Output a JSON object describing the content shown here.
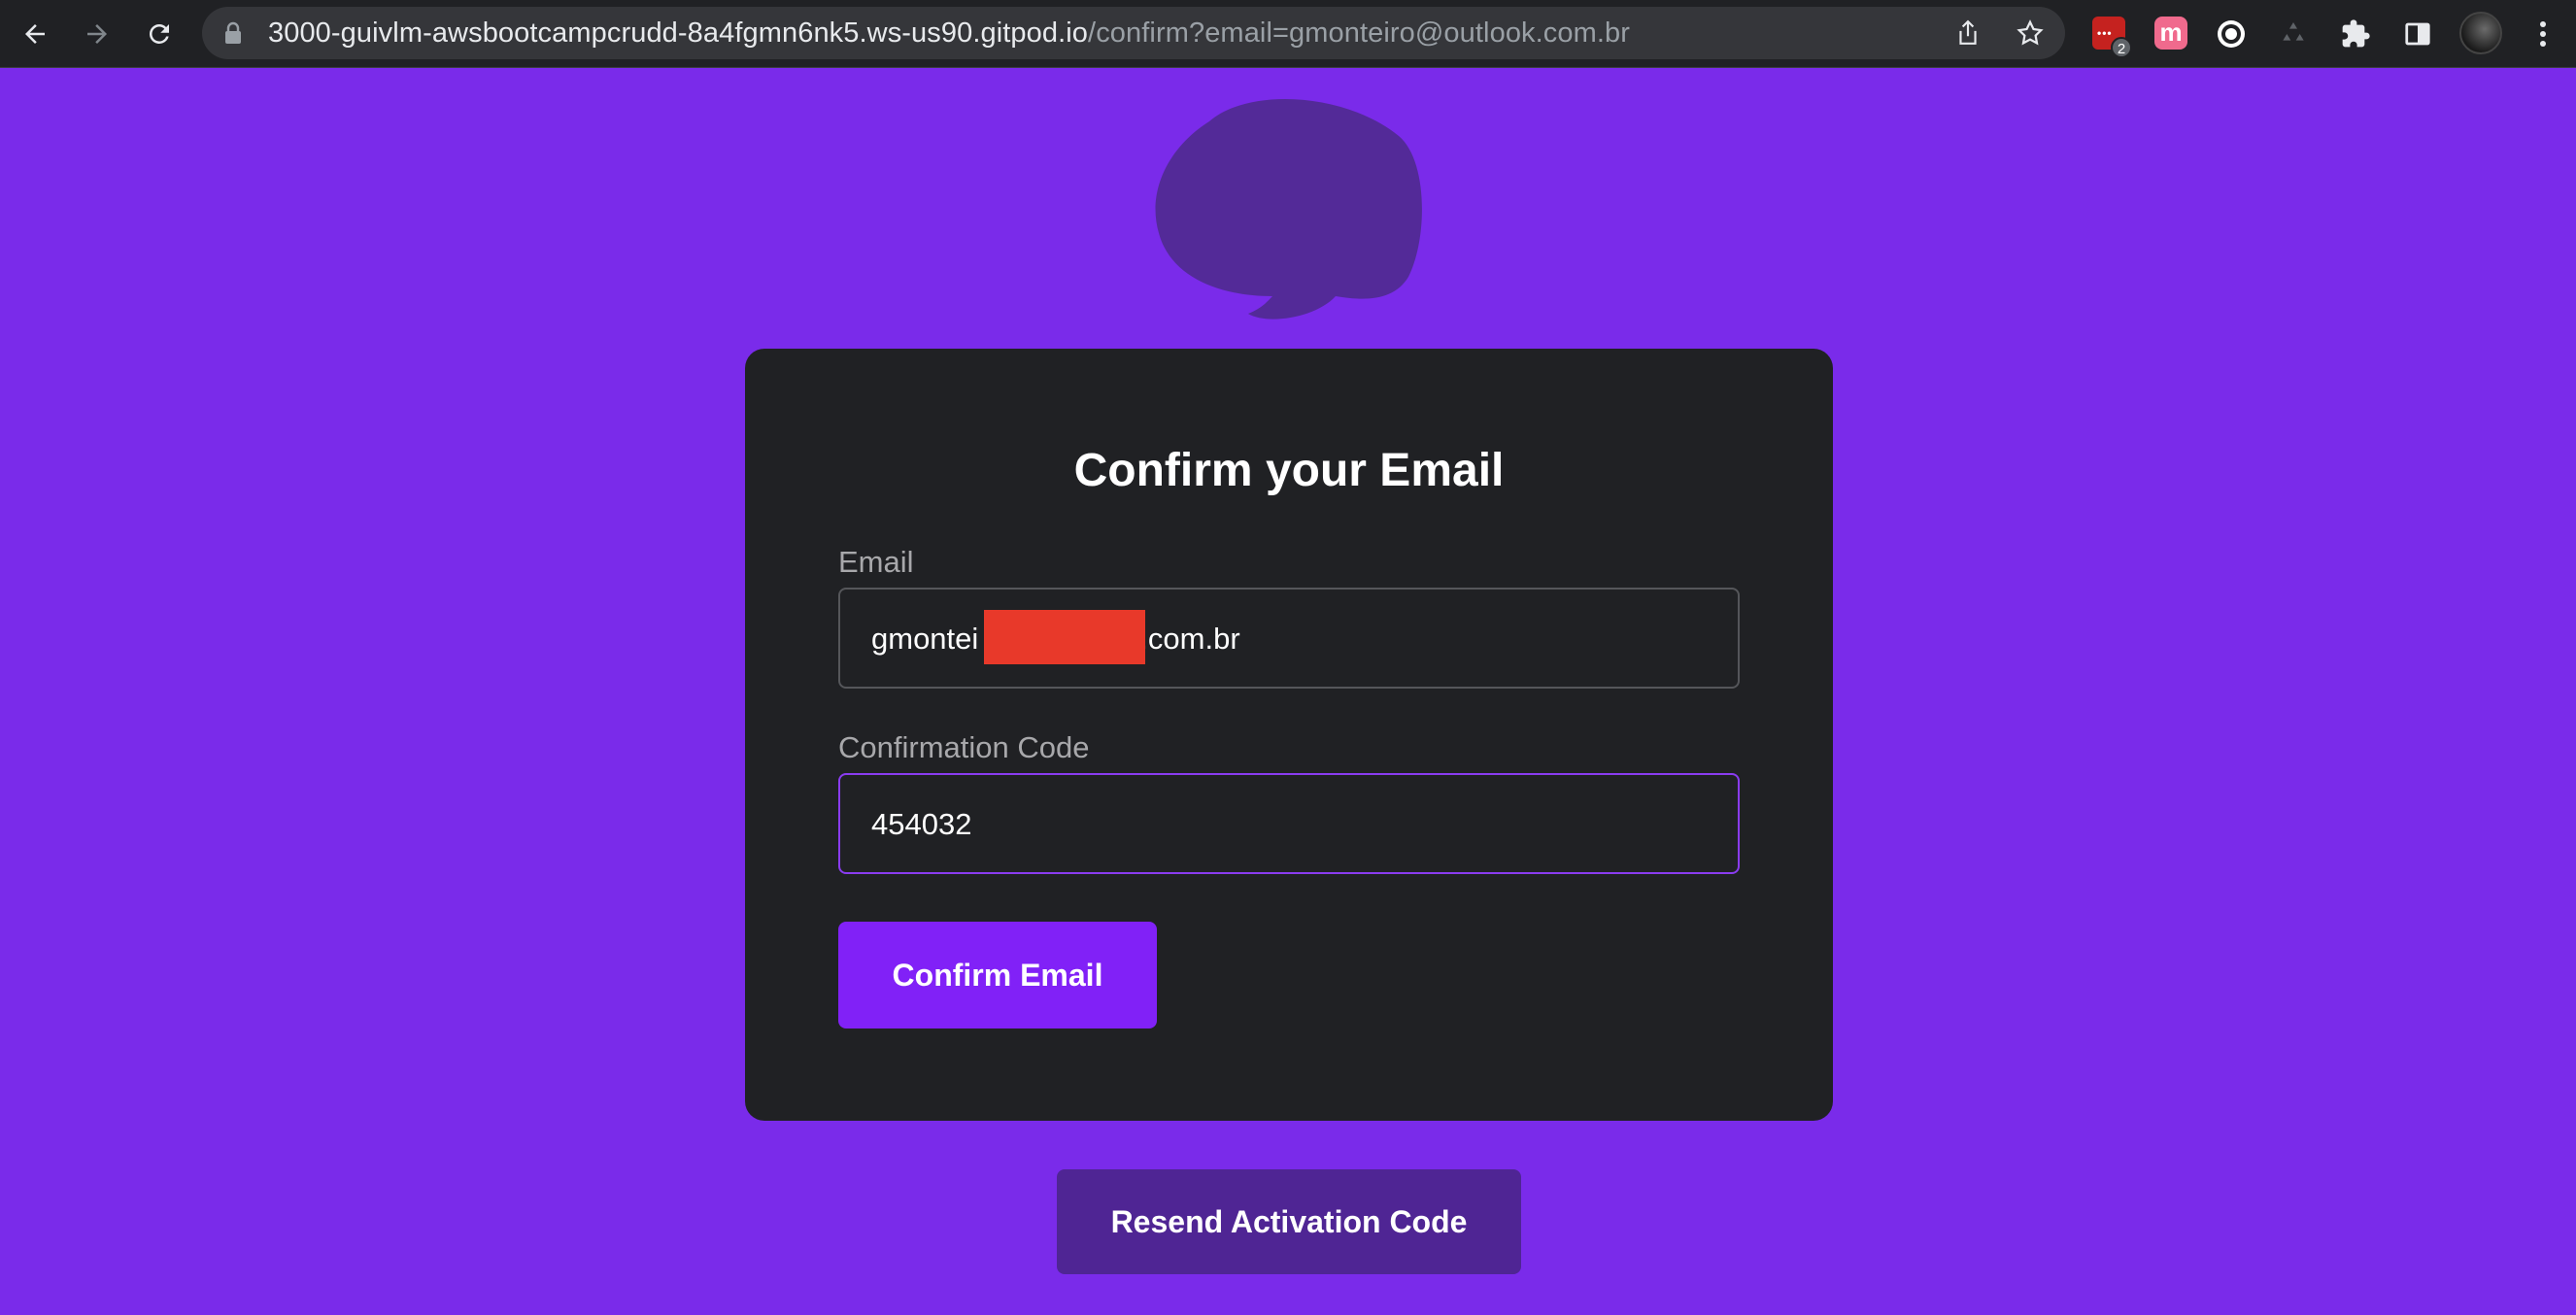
{
  "browser": {
    "url_host": "3000-guivlm-awsbootcampcrudd-8a4fgmn6nk5.ws-us90.gitpod.io",
    "url_path": "/confirm?email=gmonteiro@outlook.com.br",
    "extension_badge_count": "2",
    "extension_m_label": "m",
    "icons": [
      "back-arrow-icon",
      "forward-arrow-icon",
      "reload-icon",
      "lock-icon",
      "share-icon",
      "bookmark-star-icon",
      "puzzle-extensions-icon",
      "side-panel-icon",
      "kebab-menu-icon"
    ]
  },
  "logo": {
    "icon": "speech-bubble-logo-icon",
    "color": "#532a98"
  },
  "form": {
    "title": "Confirm your Email",
    "email_label": "Email",
    "email_value_prefix": "gmontei",
    "email_value_suffix": ".com.br",
    "code_label": "Confirmation Code",
    "code_value": "454032",
    "confirm_button_label": "Confirm Email"
  },
  "resend_button_label": "Resend Activation Code",
  "colors": {
    "page_background": "#7a2bea",
    "card_background": "#202124",
    "primary_button": "#8121f7",
    "secondary_button": "#4f2594",
    "focus_border": "#8a3cf0",
    "redaction": "#e8392a"
  }
}
